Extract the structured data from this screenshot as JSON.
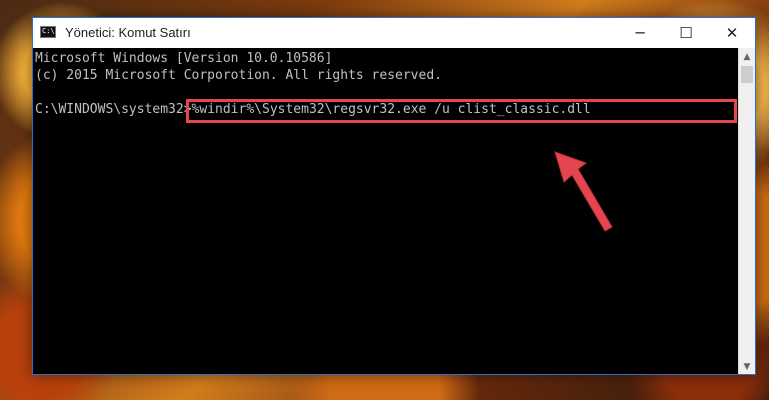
{
  "window": {
    "title": "Yönetici: Komut Satırı",
    "controls": {
      "minimize": "─",
      "maximize": "☐",
      "close": "✕"
    }
  },
  "console": {
    "line1": "Microsoft Windows [Version 10.0.10586]",
    "line2": "(c) 2015 Microsoft Corporotion. All rights reserved.",
    "prompt": "C:\\WINDOWS\\system32>",
    "command": "%windir%\\System32\\regsvr32.exe /u clist_classic.dll"
  },
  "scrollbar": {
    "up": "▲",
    "down": "▼"
  },
  "colors": {
    "highlight": "#e5454f",
    "arrow": "#e5454f",
    "console_bg": "#000000",
    "console_text": "#c0c0c0"
  },
  "icons": {
    "app": "cmd-icon",
    "annotation": "arrow-pointer-icon"
  }
}
